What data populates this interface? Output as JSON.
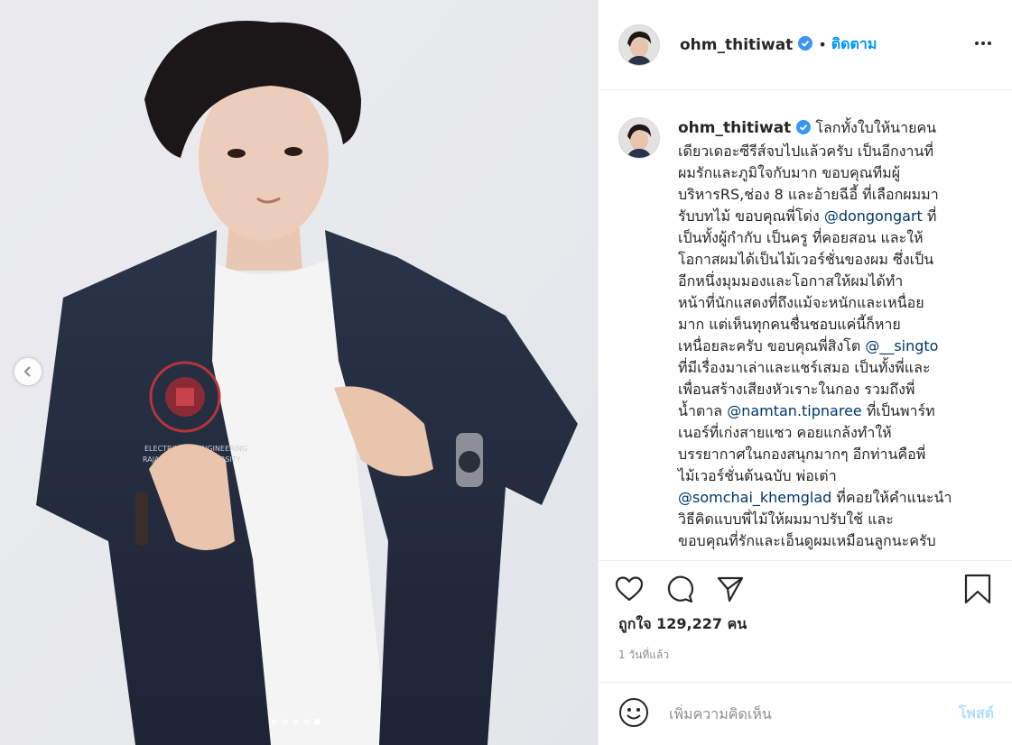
{
  "colors": {
    "accent": "#0095f6",
    "mention": "#00376b",
    "muted": "#8e8e8e",
    "post_disabled": "#b2dffc",
    "verified": "#3897f0"
  },
  "media": {
    "carousel_dots": 5,
    "active_dot": 5
  },
  "header": {
    "username": "ohm_thitiwat",
    "bullet": "•",
    "follow_label": "ติดตาม",
    "more_icon": "more-horizontal-icon"
  },
  "caption": {
    "username": "ohm_thitiwat",
    "lines": [
      "โลกทั้งใบให้นายคน",
      "เดียวเดอะซีรีส์จบไปแล้วครับ เป็นอีกงานที่",
      "ผมรักและภูมิใจกับมาก ขอบคุณทีมผู้",
      "บริหารRS,ช่อง 8 และอ้ายฉีอี้ ที่เลือกผมมา",
      "รับบทไม้ ขอบคุณพี่โด่ง ",
      "@dongongart",
      " ที่",
      "เป็นทั้งผู้กำกับ เป็นครู ที่คอยสอน และให้",
      "โอกาสผมได้เป็นไม้เวอร์ชั่นของผม ซึ่งเป็น",
      "อีกหนึ่งมุมมองและโอกาสให้ผมได้ทำ",
      "หน้าที่นักแสดงที่ถึงแม้จะหนักและเหนื่อย",
      "มาก แต่เห็นทุกคนชื่นชอบแค่นี้ก็หาย",
      "เหนื่อยละครับ ขอบคุณพี่สิงโต ",
      "@__singto",
      "ที่มีเรื่องมาเล่าและแชร์เสมอ เป็นทั้งพี่และ",
      "เพื่อนสร้างเสียงหัวเราะในกอง รวมถึงพี่",
      "น้ำตาล ",
      "@namtan.tipnaree",
      " ที่เป็นพาร์ท",
      "เนอร์ที่เก่งสายแซว คอยแกล้งทำให้",
      "บรรยากาศในกองสนุกมากๆ อีกท่านคือพี่",
      "ไม้เวอร์ชั่นต้นฉบับ พ่อเต่า",
      "@somchai_khemglad",
      " ที่คอยให้คำแนะนำ",
      "วิธีคิดแบบพี่ไม้ให้ผมมาปรับใช้ และ",
      "ขอบคุณที่รักและเอ็นดูผมเหมือนลูกนะครับ"
    ]
  },
  "actions": {
    "like_icon": "heart-icon",
    "comment_icon": "comment-icon",
    "share_icon": "share-icon",
    "save_icon": "bookmark-icon"
  },
  "likes_text": "ถูกใจ 129,227 คน",
  "time_text": "1 วันที่แล้ว",
  "comment": {
    "emoji_icon": "emoji-icon",
    "placeholder": "เพิ่มความคิดเห็น",
    "post_label": "โพสต์"
  }
}
